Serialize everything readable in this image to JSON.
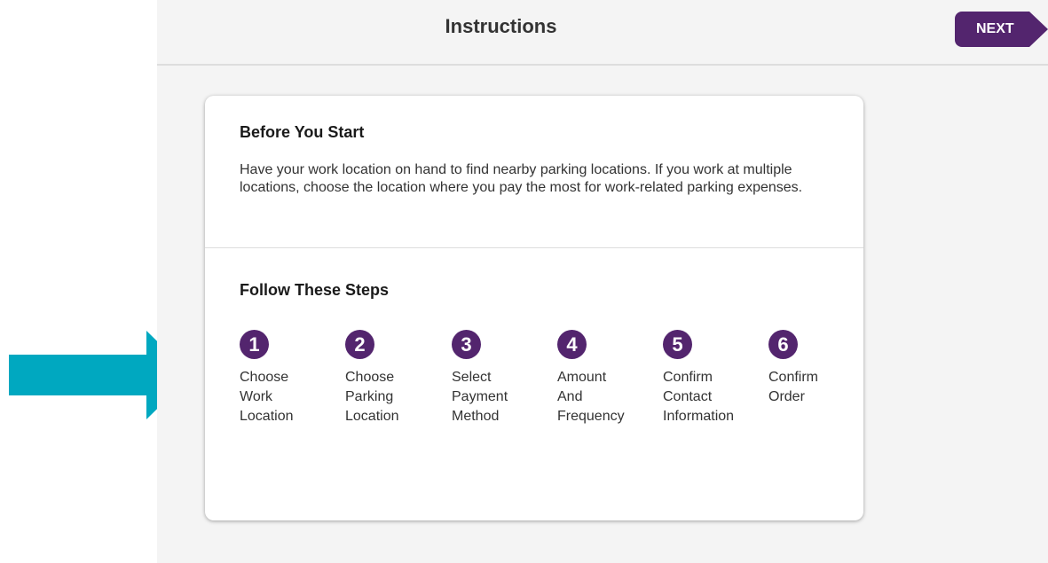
{
  "header": {
    "title": "Instructions",
    "next_label": "NEXT"
  },
  "before_you_start": {
    "title": "Before You Start",
    "body": "Have your work location on hand to find nearby parking locations. If you work at multiple locations, choose the location where you pay the most for work-related parking expenses."
  },
  "follow_steps": {
    "title": "Follow These Steps",
    "steps": [
      {
        "number": "1",
        "label": "Choose\nWork\nLocation"
      },
      {
        "number": "2",
        "label": "Choose\nParking\nLocation"
      },
      {
        "number": "3",
        "label": "Select\nPayment\nMethod"
      },
      {
        "number": "4",
        "label": "Amount\nAnd\nFrequency"
      },
      {
        "number": "5",
        "label": "Confirm\nContact\nInformation"
      },
      {
        "number": "6",
        "label": "Confirm\nOrder"
      }
    ]
  },
  "colors": {
    "accent_purple": "#53256e",
    "arrow_teal": "#00a8c0"
  },
  "annotation": {
    "arrow_icon": "arrow-right-icon"
  }
}
